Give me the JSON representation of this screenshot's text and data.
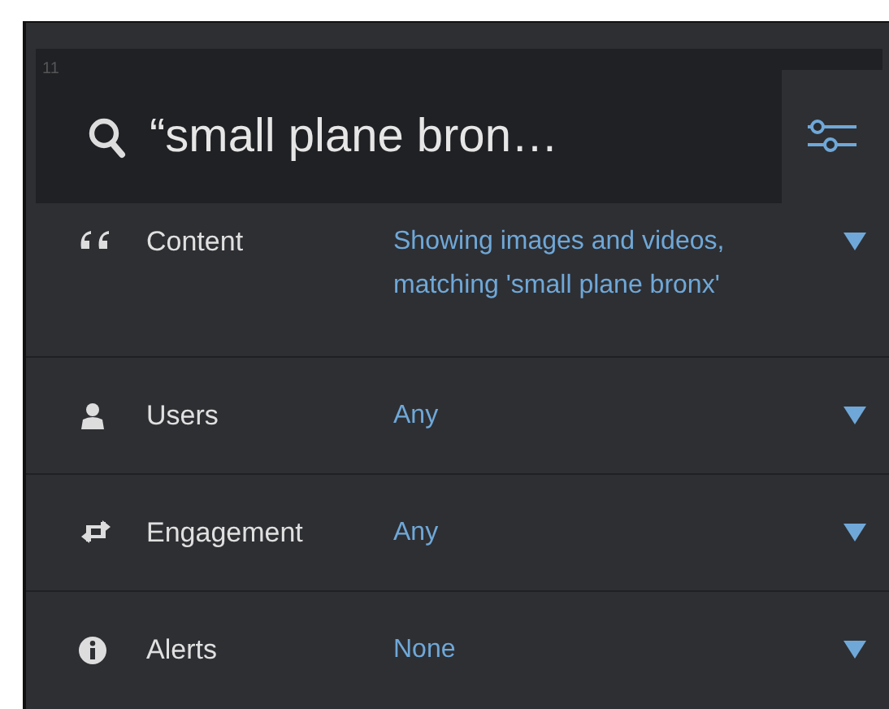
{
  "panel": {
    "badge": "11"
  },
  "search": {
    "value": "“small plane bron…"
  },
  "filters_button": {
    "selected": true
  },
  "filters": [
    {
      "kind": "quote",
      "label": "Content",
      "value": "Showing images and videos, matching 'small plane bronx'"
    },
    {
      "kind": "user",
      "label": "Users",
      "value": "Any"
    },
    {
      "kind": "retweet",
      "label": "Engagement",
      "value": "Any"
    },
    {
      "kind": "info",
      "label": "Alerts",
      "value": "None"
    }
  ]
}
